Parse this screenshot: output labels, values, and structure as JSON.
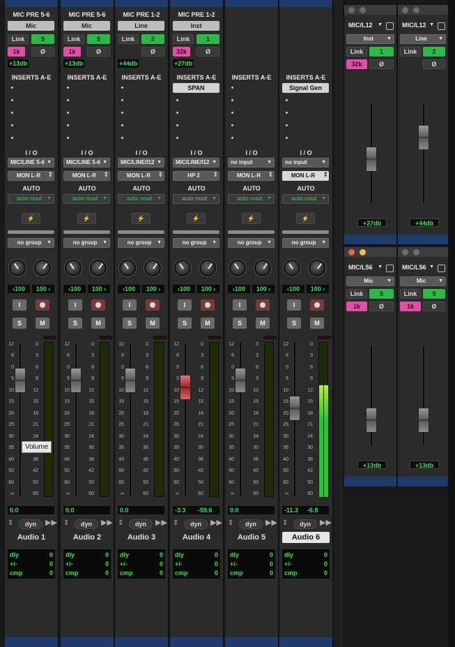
{
  "strips": [
    {
      "title": "MIC PRE  5-6",
      "input": "Mic",
      "link": "Link",
      "link_val": "5",
      "hpf": "1k",
      "phase": "Ø",
      "gain": "+13db",
      "insert": "",
      "io_in": "MIC/LINE 5-6",
      "io_out": "MON L-R",
      "auto": "auto read",
      "group": "no group",
      "pan_l": "‹100",
      "pan_r": "100 ›",
      "vol_l": "0.0",
      "vol_r": "",
      "name": "Audio 1"
    },
    {
      "title": "MIC PRE  5-6",
      "input": "Mic",
      "link": "Link",
      "link_val": "5",
      "hpf": "1k",
      "phase": "Ø",
      "gain": "+13db",
      "insert": "",
      "io_in": "MIC/LINE 5-6",
      "io_out": "MON L-R",
      "auto": "auto read",
      "group": "no group",
      "pan_l": "‹100",
      "pan_r": "100 ›",
      "vol_l": "0.0",
      "vol_r": "",
      "name": "Audio 2"
    },
    {
      "title": "MIC PRE  1-2",
      "input": "Line",
      "link": "Link",
      "link_val": "2",
      "hpf": "",
      "phase": "Ø",
      "gain": "+44db",
      "insert": "",
      "io_in": "MIC/LINE/I12",
      "io_out": "MON L-R",
      "auto": "auto read",
      "group": "no group",
      "pan_l": "‹100",
      "pan_r": "100 ›",
      "vol_l": "0.0",
      "vol_r": "",
      "name": "Audio 3"
    },
    {
      "title": "MIC PRE  1-2",
      "input": "Inst",
      "link": "Link",
      "link_val": "1",
      "hpf": "32k",
      "phase": "Ø",
      "gain": "+27db",
      "insert": "SPAN",
      "io_in": "MIC/LINE/I12",
      "io_out": "HP 2",
      "auto": "auto read",
      "group": "no group",
      "pan_l": "‹100",
      "pan_r": "100 ›",
      "vol_l": "-3.3",
      "vol_r": "-59.6",
      "name": "Audio 4"
    },
    {
      "title": "",
      "input": "",
      "link": "",
      "link_val": "",
      "hpf": "",
      "phase": "",
      "gain": "",
      "insert": "",
      "io_in": "no input",
      "io_out": "MON L-R",
      "auto": "auto read",
      "group": "no group",
      "pan_l": "‹100",
      "pan_r": "100 ›",
      "vol_l": "0.0",
      "vol_r": "",
      "name": "Audio 5"
    },
    {
      "title": "",
      "input": "",
      "link": "",
      "link_val": "",
      "hpf": "",
      "phase": "",
      "gain": "",
      "insert": "Signal Gen",
      "io_in": "no input",
      "io_out": "MON L-R",
      "auto": "auto read",
      "group": "no group",
      "pan_l": "‹100",
      "pan_r": "100 ›",
      "vol_l": "-11.3",
      "vol_r": "-6.8",
      "name": "Audio 6"
    }
  ],
  "labels": {
    "inserts": "INSERTS A-E",
    "io": "I / O",
    "auto": "AUTO",
    "input_mon": "I",
    "solo": "S",
    "mute": "M",
    "dyn": "dyn",
    "dly": "dly",
    "pm": "+/-",
    "cmp": "cmp",
    "zero": "0"
  },
  "scale": [
    "12",
    "6",
    "0",
    "5",
    "10",
    "15",
    "20",
    "25",
    "30",
    "35",
    "40",
    "50",
    "60",
    "∞"
  ],
  "scale_r": [
    "0",
    "3",
    "6",
    "9",
    "12",
    "15",
    "18",
    "21",
    "24",
    "30",
    "36",
    "42",
    "50",
    "60"
  ],
  "tooltip": "Volume",
  "plugins": [
    {
      "title": "MIC/L12",
      "input": "Inst",
      "link": "Link",
      "link_val": "1",
      "hpf": "32k",
      "phase": "Ø",
      "gain": "+27db"
    },
    {
      "title": "MIC/L12",
      "input": "Line",
      "link": "Link",
      "link_val": "2",
      "hpf": "",
      "phase": "Ø",
      "gain": "+44db"
    },
    {
      "title": "MIC/L56",
      "input": "Mic",
      "link": "Link",
      "link_val": "5",
      "hpf": "1k",
      "phase": "Ø",
      "gain": "+13db"
    },
    {
      "title": "MIC/L56",
      "input": "Mic",
      "link": "Link",
      "link_val": "5",
      "hpf": "1k",
      "phase": "Ø",
      "gain": "+13db"
    }
  ],
  "colors": {
    "accent_green": "#2fb84a",
    "accent_pink": "#e24fa6",
    "band_blue": "#1f3b6e",
    "meter_green": "#3ee25a"
  },
  "levels": {
    "fader_db": [
      0.0,
      0.0,
      0.0,
      -3.3,
      0.0,
      -11.3
    ],
    "meter_audio6": [
      0.72,
      0.72
    ]
  }
}
